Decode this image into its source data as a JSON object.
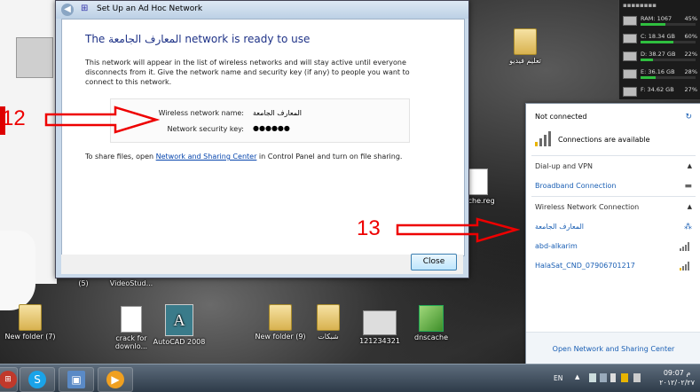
{
  "dialog": {
    "title": "Set Up an Ad Hoc Network",
    "heading": "The المعارف الجامعة network is ready to use",
    "description": "This network will appear in the list of wireless networks and will stay active until everyone disconnects from it. Give the network name and security key (if any) to people you want to connect to this network.",
    "name_label": "Wireless network name:",
    "name_value": "المعارف الجامعة",
    "key_label": "Network security key:",
    "key_value": "●●●●●●",
    "share_prefix": "To share files, open ",
    "share_link": "Network and Sharing Center",
    "share_suffix": " in Control Panel and turn on file sharing.",
    "close_label": "Close"
  },
  "annotations": {
    "n12": "12",
    "n13": "13"
  },
  "desktop_icons": [
    {
      "label": "تعليم فيديو",
      "kind": "folder"
    },
    {
      "label": "cache.reg",
      "kind": "doc"
    },
    {
      "label": "New folder (7)",
      "kind": "folder"
    },
    {
      "label": "crack for downlo...",
      "kind": "doc"
    },
    {
      "label": "AutoCAD 2008",
      "kind": "autocad"
    },
    {
      "label": "New folder (9)",
      "kind": "folder"
    },
    {
      "label": "شبكات",
      "kind": "folder"
    },
    {
      "label": "121234321",
      "kind": "image"
    },
    {
      "label": "dnscache",
      "kind": "cube"
    },
    {
      "label": "(5)",
      "kind": "text"
    },
    {
      "label": "VideoStud...",
      "kind": "text"
    }
  ],
  "gadget": {
    "ram": {
      "label": "RAM: 1067",
      "pct": "45%",
      "level": 0.45
    },
    "c": {
      "label": "C:    18.34 GB",
      "pct": "60%",
      "level": 0.6
    },
    "d": {
      "label": "D:    38.27 GB",
      "pct": "22%",
      "level": 0.22
    },
    "e": {
      "label": "E:    36.16 GB",
      "pct": "28%",
      "level": 0.28
    },
    "f": {
      "label": "F:    34.62 GB",
      "pct": "27%",
      "level": 0.27
    }
  },
  "flyout": {
    "status": "Not connected",
    "available": "Connections are available",
    "dialup_section": "Dial-up and VPN",
    "broadband": "Broadband Connection",
    "wireless_section": "Wireless Network Connection",
    "networks": [
      "المعارف الجامعة",
      "abd-alkarim",
      "HalaSat_CND_07906701217"
    ],
    "footer": "Open Network and Sharing Center"
  },
  "taskbar": {
    "lang": "EN",
    "time": "09:07 م",
    "date": "٢٠١٢/٠٢/٢٧"
  }
}
